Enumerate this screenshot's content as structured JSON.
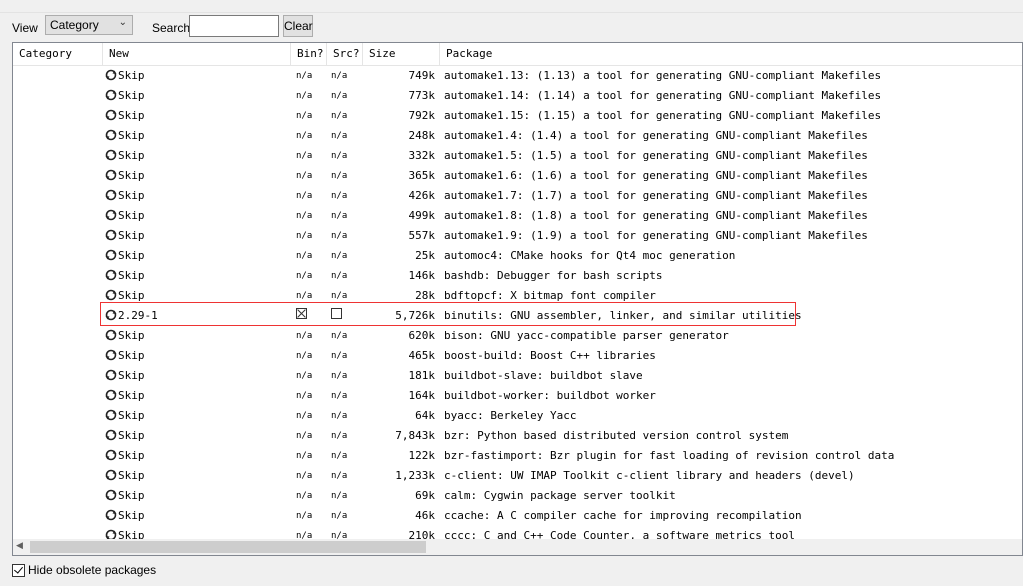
{
  "toolbar": {
    "view_label": "View",
    "view_value": "Category",
    "search_label": "Search",
    "search_value": "",
    "clear_label": "Clear"
  },
  "columns": [
    "Category",
    "New",
    "Bin?",
    "Src?",
    "Size",
    "Package"
  ],
  "rows": [
    {
      "new": "Skip",
      "bin": "n/a",
      "src": "n/a",
      "size": "749k",
      "pkg": "automake1.13: (1.13) a tool for generating GNU-compliant Makefiles"
    },
    {
      "new": "Skip",
      "bin": "n/a",
      "src": "n/a",
      "size": "773k",
      "pkg": "automake1.14: (1.14) a tool for generating GNU-compliant Makefiles"
    },
    {
      "new": "Skip",
      "bin": "n/a",
      "src": "n/a",
      "size": "792k",
      "pkg": "automake1.15: (1.15) a tool for generating GNU-compliant Makefiles"
    },
    {
      "new": "Skip",
      "bin": "n/a",
      "src": "n/a",
      "size": "248k",
      "pkg": "automake1.4: (1.4) a tool for generating GNU-compliant Makefiles"
    },
    {
      "new": "Skip",
      "bin": "n/a",
      "src": "n/a",
      "size": "332k",
      "pkg": "automake1.5: (1.5) a tool for generating GNU-compliant Makefiles"
    },
    {
      "new": "Skip",
      "bin": "n/a",
      "src": "n/a",
      "size": "365k",
      "pkg": "automake1.6: (1.6) a tool for generating GNU-compliant Makefiles"
    },
    {
      "new": "Skip",
      "bin": "n/a",
      "src": "n/a",
      "size": "426k",
      "pkg": "automake1.7: (1.7) a tool for generating GNU-compliant Makefiles"
    },
    {
      "new": "Skip",
      "bin": "n/a",
      "src": "n/a",
      "size": "499k",
      "pkg": "automake1.8: (1.8) a tool for generating GNU-compliant Makefiles"
    },
    {
      "new": "Skip",
      "bin": "n/a",
      "src": "n/a",
      "size": "557k",
      "pkg": "automake1.9: (1.9) a tool for generating GNU-compliant Makefiles"
    },
    {
      "new": "Skip",
      "bin": "n/a",
      "src": "n/a",
      "size": "25k",
      "pkg": "automoc4: CMake hooks for Qt4 moc generation"
    },
    {
      "new": "Skip",
      "bin": "n/a",
      "src": "n/a",
      "size": "146k",
      "pkg": "bashdb: Debugger for bash scripts"
    },
    {
      "new": "Skip",
      "bin": "n/a",
      "src": "n/a",
      "size": "28k",
      "pkg": "bdftopcf: X bitmap font compiler"
    },
    {
      "new": "2.29-1",
      "bin": "checked",
      "src": "unchecked",
      "size": "5,726k",
      "pkg": "binutils: GNU assembler, linker, and similar utilities"
    },
    {
      "new": "Skip",
      "bin": "n/a",
      "src": "n/a",
      "size": "620k",
      "pkg": "bison: GNU yacc-compatible parser generator"
    },
    {
      "new": "Skip",
      "bin": "n/a",
      "src": "n/a",
      "size": "465k",
      "pkg": "boost-build: Boost C++ libraries"
    },
    {
      "new": "Skip",
      "bin": "n/a",
      "src": "n/a",
      "size": "181k",
      "pkg": "buildbot-slave: buildbot slave"
    },
    {
      "new": "Skip",
      "bin": "n/a",
      "src": "n/a",
      "size": "164k",
      "pkg": "buildbot-worker: buildbot worker"
    },
    {
      "new": "Skip",
      "bin": "n/a",
      "src": "n/a",
      "size": "64k",
      "pkg": "byacc: Berkeley Yacc"
    },
    {
      "new": "Skip",
      "bin": "n/a",
      "src": "n/a",
      "size": "7,843k",
      "pkg": "bzr: Python based distributed version control system"
    },
    {
      "new": "Skip",
      "bin": "n/a",
      "src": "n/a",
      "size": "122k",
      "pkg": "bzr-fastimport: Bzr plugin for fast loading of revision control data"
    },
    {
      "new": "Skip",
      "bin": "n/a",
      "src": "n/a",
      "size": "1,233k",
      "pkg": "c-client: UW IMAP Toolkit c-client library and headers (devel)"
    },
    {
      "new": "Skip",
      "bin": "n/a",
      "src": "n/a",
      "size": "69k",
      "pkg": "calm: Cygwin package server toolkit"
    },
    {
      "new": "Skip",
      "bin": "n/a",
      "src": "n/a",
      "size": "46k",
      "pkg": "ccache: A C compiler cache for improving recompilation"
    },
    {
      "new": "Skip",
      "bin": "n/a",
      "src": "n/a",
      "size": "210k",
      "pkg": "cccc: C and C++ Code Counter, a software metrics tool"
    }
  ],
  "footer": {
    "hide_obsolete_label": "Hide obsolete packages",
    "hide_obsolete_checked": true
  },
  "colors": {
    "highlight": "#e33333",
    "background": "#f0f0f0"
  }
}
